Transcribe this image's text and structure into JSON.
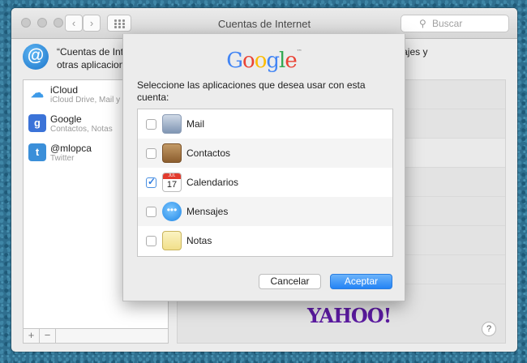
{
  "window": {
    "title": "Cuentas de Internet",
    "search_placeholder": "Buscar",
    "nav_back": "‹",
    "nav_forward": "›"
  },
  "header": {
    "text": "“Cuentas de Internet configura sus cuentas para su uso con Mail, Contactos, Calendario, Mensajes y otras aplicaciones.",
    "text_visible_left": "“Cuentas de Int",
    "text_visible_right": "endario, Mensajes y",
    "text_line2": "otras aplicacion"
  },
  "accounts": [
    {
      "name": "iCloud",
      "sub": "iCloud Drive, Mail y",
      "icon": "icloud-icon"
    },
    {
      "name": "Google",
      "sub": "Contactos, Notas",
      "icon": "google-icon"
    },
    {
      "name": "@mlopca",
      "sub": "Twitter",
      "icon": "twitter-icon"
    }
  ],
  "list_buttons": {
    "add": "+",
    "remove": "−"
  },
  "right_pane": {
    "provider_logo": "YAHOO!",
    "help": "?"
  },
  "dialog": {
    "logo": "Google",
    "prompt": "Seleccione las aplicaciones que desea usar con esta cuenta:",
    "apps": [
      {
        "label": "Mail",
        "checked": false,
        "icon": "mail-icon"
      },
      {
        "label": "Contactos",
        "checked": false,
        "icon": "contacts-icon"
      },
      {
        "label": "Calendarios",
        "checked": true,
        "icon": "calendar-icon"
      },
      {
        "label": "Mensajes",
        "checked": false,
        "icon": "messages-icon"
      },
      {
        "label": "Notas",
        "checked": false,
        "icon": "notes-icon"
      }
    ],
    "calendar_day": "17",
    "calendar_month": "JUL",
    "cancel": "Cancelar",
    "accept": "Aceptar"
  },
  "colors": {
    "accent": "#2383f5",
    "yahoo": "#5b1aa0"
  }
}
